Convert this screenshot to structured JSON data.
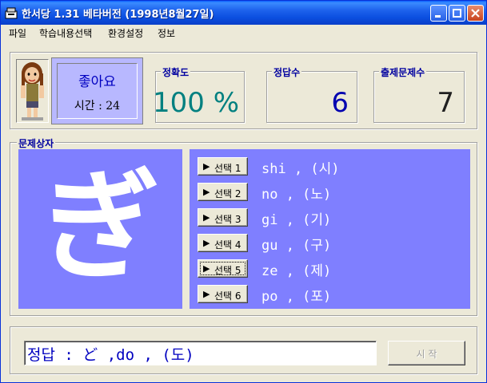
{
  "window": {
    "title": "한서당 1.31 베타버전 (1998년8월27일)"
  },
  "menu": {
    "items": [
      "파일",
      "학습내용선택",
      "환경설정",
      "정보"
    ]
  },
  "status": {
    "mood": "좋아요",
    "time_label": "시간 : 24"
  },
  "stats": {
    "accuracy": {
      "label": "정확도",
      "value": "100 %"
    },
    "correct": {
      "label": "정답수",
      "value": "6"
    },
    "total": {
      "label": "출제문제수",
      "value": "7"
    }
  },
  "question": {
    "label": "문제상자",
    "character": "ぎ"
  },
  "answers": [
    {
      "button": "선택 1",
      "text": "shi , (시)"
    },
    {
      "button": "선택 2",
      "text": "no , (노)"
    },
    {
      "button": "선택 3",
      "text": "gi , (기)"
    },
    {
      "button": "선택 4",
      "text": "gu , (구)"
    },
    {
      "button": "선택 5",
      "text": "ze , (제)"
    },
    {
      "button": "선택 6",
      "text": "po , (포)"
    }
  ],
  "footer": {
    "result": "정답 : ど ,do , (도)",
    "start_button": "시 작"
  },
  "colors": {
    "accent_blue": "#7F7FFF",
    "teal": "#008080",
    "navy": "#0000A0"
  }
}
